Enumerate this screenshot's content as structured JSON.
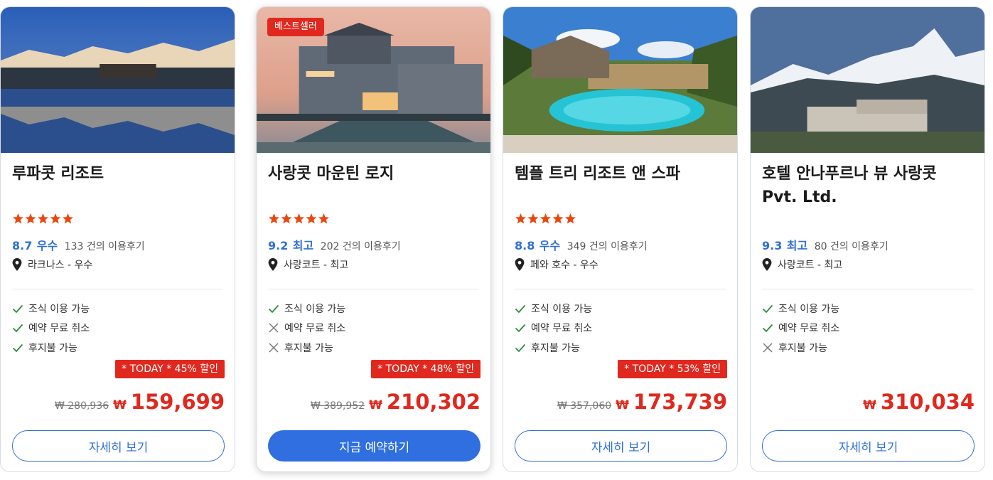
{
  "accent": "#2f6fd6",
  "sale_color": "#e0281e",
  "cards": [
    {
      "badge": "베스트셀러",
      "title": "사랑콧 마운틴 로지",
      "stars": 5,
      "score": "9.2",
      "score_word": "최고",
      "reviews": "202 건의 이용후기",
      "location": "사랑코트 - 최고",
      "features": [
        {
          "label": "조식 이용 가능",
          "available": true,
          "icon": "check-icon"
        },
        {
          "label": "예약 무료 취소",
          "available": false,
          "icon": "x-icon"
        },
        {
          "label": "후지불 가능",
          "available": false,
          "icon": "x-icon"
        }
      ],
      "discount": "* TODAY * 48% 할인",
      "old_price": "₩ 389,952",
      "currency": "₩",
      "price": "210,302",
      "button": "지금 예약하기"
    },
    {
      "title": "템플 트리 리조트 앤 스파",
      "stars": 5,
      "score": "8.8",
      "score_word": "우수",
      "reviews": "349 건의 이용후기",
      "location": "페와 호수 - 우수",
      "features": [
        {
          "label": "조식 이용 가능",
          "available": true,
          "icon": "check-icon"
        },
        {
          "label": "예약 무료 취소",
          "available": true,
          "icon": "check-icon"
        },
        {
          "label": "후지불 가능",
          "available": true,
          "icon": "check-icon"
        }
      ],
      "discount": "* TODAY * 53% 할인",
      "old_price": "₩ 357,060",
      "currency": "₩",
      "price": "173,739",
      "button": "자세히 보기"
    },
    {
      "title": "호텔 안나푸르나 뷰 사랑콧 Pvt. Ltd.",
      "score": "9.3",
      "score_word": "최고",
      "reviews": "80 건의 이용후기",
      "location": "사랑코트 - 최고",
      "features": [
        {
          "label": "조식 이용 가능",
          "available": true,
          "icon": "check-icon"
        },
        {
          "label": "예약 무료 취소",
          "available": true,
          "icon": "check-icon"
        },
        {
          "label": "후지불 가능",
          "available": false,
          "icon": "x-icon"
        }
      ],
      "currency": "₩",
      "price": "310,034",
      "button": "자세히 보기"
    },
    {
      "title": "루파콧 리조트",
      "stars": 5,
      "score": "8.7",
      "score_word": "우수",
      "reviews": "133 건의 이용후기",
      "location": "라크나스 - 우수",
      "features": [
        {
          "label": "조식 이용 가능",
          "available": true,
          "icon": "check-icon"
        },
        {
          "label": "예약 무료 취소",
          "available": true,
          "icon": "check-icon"
        },
        {
          "label": "후지불 가능",
          "available": true,
          "icon": "check-icon"
        }
      ],
      "discount": "* TODAY * 45% 할인",
      "old_price": "₩ 280,936",
      "currency": "₩",
      "price": "159,699",
      "button": "자세히 보기"
    }
  ]
}
